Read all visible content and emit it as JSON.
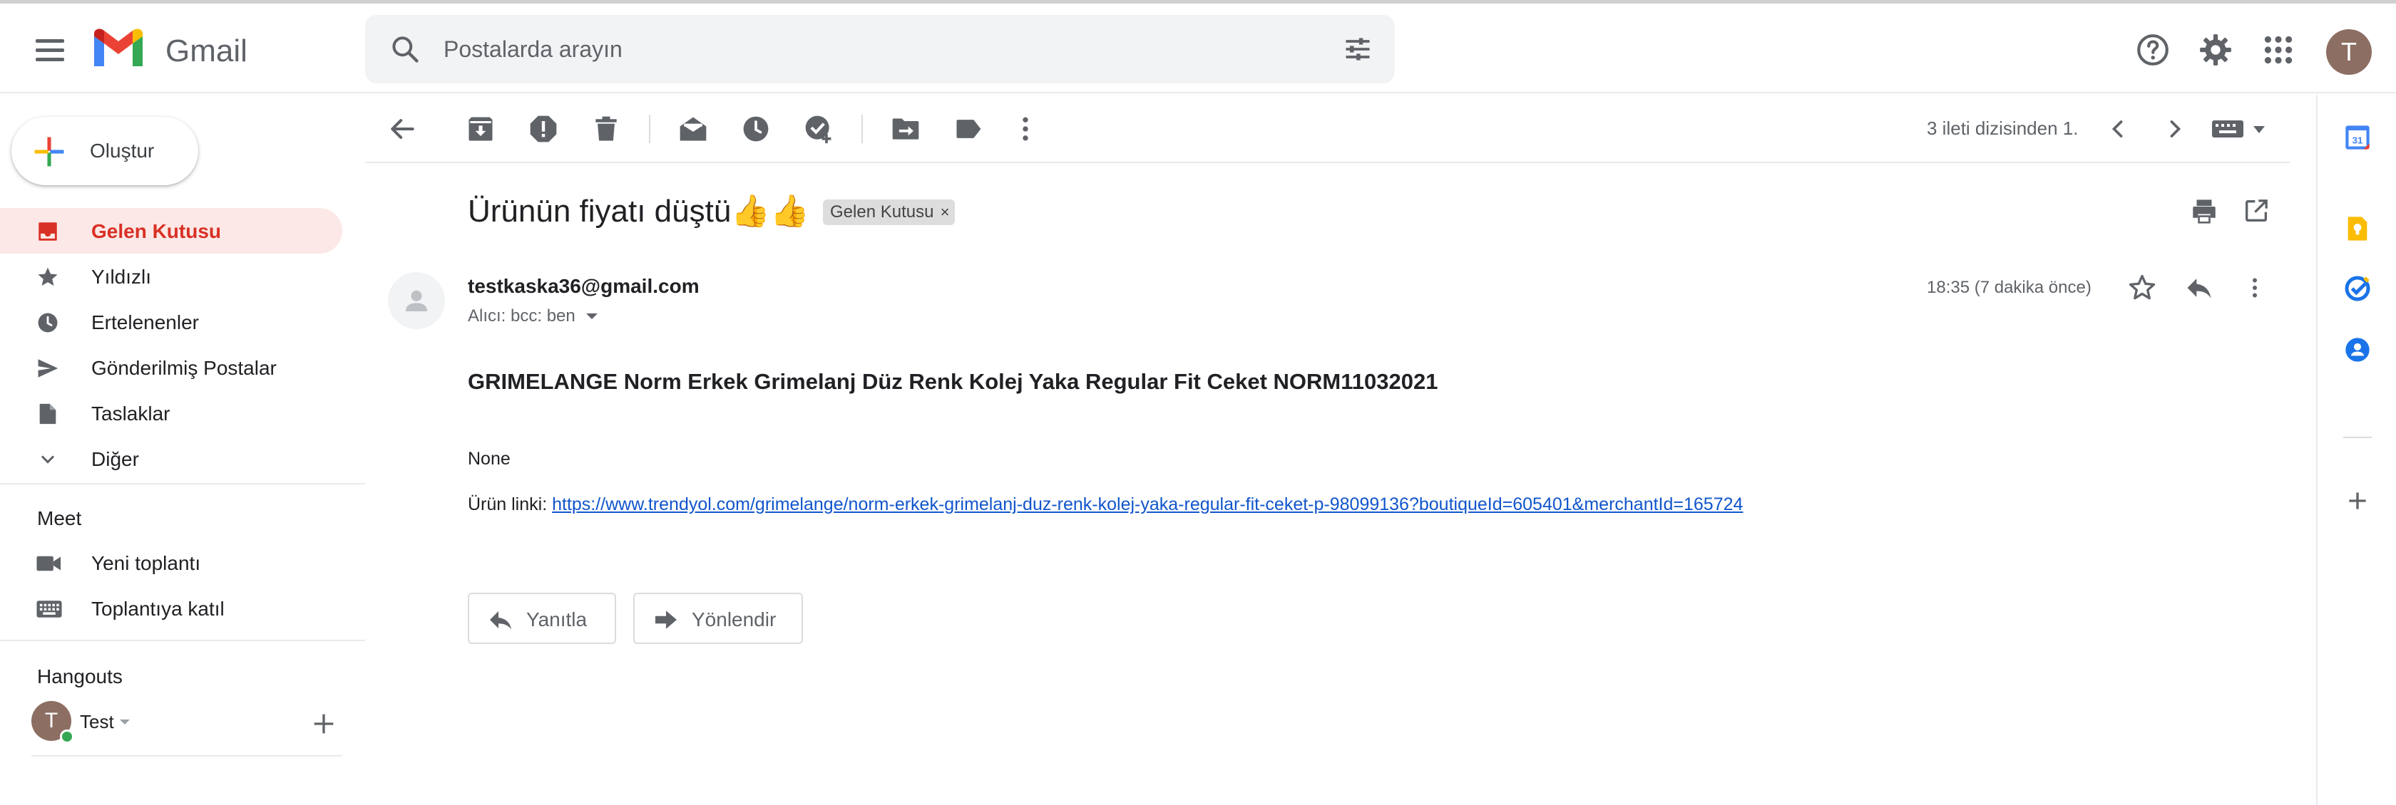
{
  "app": {
    "name": "Gmail"
  },
  "colors": {
    "accent_red": "#d93025",
    "active_bg": "#fce8e6",
    "link": "#1155cc"
  },
  "search": {
    "placeholder": "Postalarda arayın"
  },
  "header": {
    "icons": [
      "help-icon",
      "settings-icon",
      "apps-grid-icon"
    ],
    "account_initial": "T"
  },
  "compose": {
    "label": "Oluştur"
  },
  "sidebar": {
    "items": [
      {
        "label": "Gelen Kutusu",
        "icon": "inbox-icon",
        "active": true
      },
      {
        "label": "Yıldızlı",
        "icon": "star-icon"
      },
      {
        "label": "Ertelenenler",
        "icon": "clock-icon"
      },
      {
        "label": "Gönderilmiş Postalar",
        "icon": "send-icon"
      },
      {
        "label": "Taslaklar",
        "icon": "draft-icon"
      },
      {
        "label": "Diğer",
        "icon": "chevron-down-icon"
      }
    ]
  },
  "meet": {
    "title": "Meet",
    "items": [
      {
        "label": "Yeni toplantı",
        "icon": "video-icon"
      },
      {
        "label": "Toplantıya katıl",
        "icon": "keyboard-icon"
      }
    ]
  },
  "hangouts": {
    "title": "Hangouts",
    "user_name": "Test",
    "user_initial": "T"
  },
  "toolbar": {
    "pagination": "3 ileti dizisinden 1."
  },
  "email": {
    "subject": "Ürünün fiyatı düştü👍👍",
    "label_chip": "Gelen Kutusu",
    "label_remove": "×",
    "sender": "testkaska36@gmail.com",
    "recipients": "Alıcı: bcc: ben",
    "timestamp": "18:35 (7 dakika önce)",
    "body_title": "GRIMELANGE Norm Erkek Grimelanj Düz Renk Kolej Yaka Regular Fit Ceket NORM11032021",
    "body_none": "None",
    "link_prefix": "Ürün linki: ",
    "link_url": "https://www.trendyol.com/grimelange/norm-erkek-grimelanj-duz-renk-kolej-yaka-regular-fit-ceket-p-98099136?boutiqueId=605401&merchantId=165724"
  },
  "actions": {
    "reply": "Yanıtla",
    "forward": "Yönlendir"
  },
  "side_panel": {
    "icons": [
      "calendar-icon",
      "keep-icon",
      "tasks-icon",
      "contacts-icon",
      "add-icon"
    ],
    "calendar_day": "31"
  }
}
